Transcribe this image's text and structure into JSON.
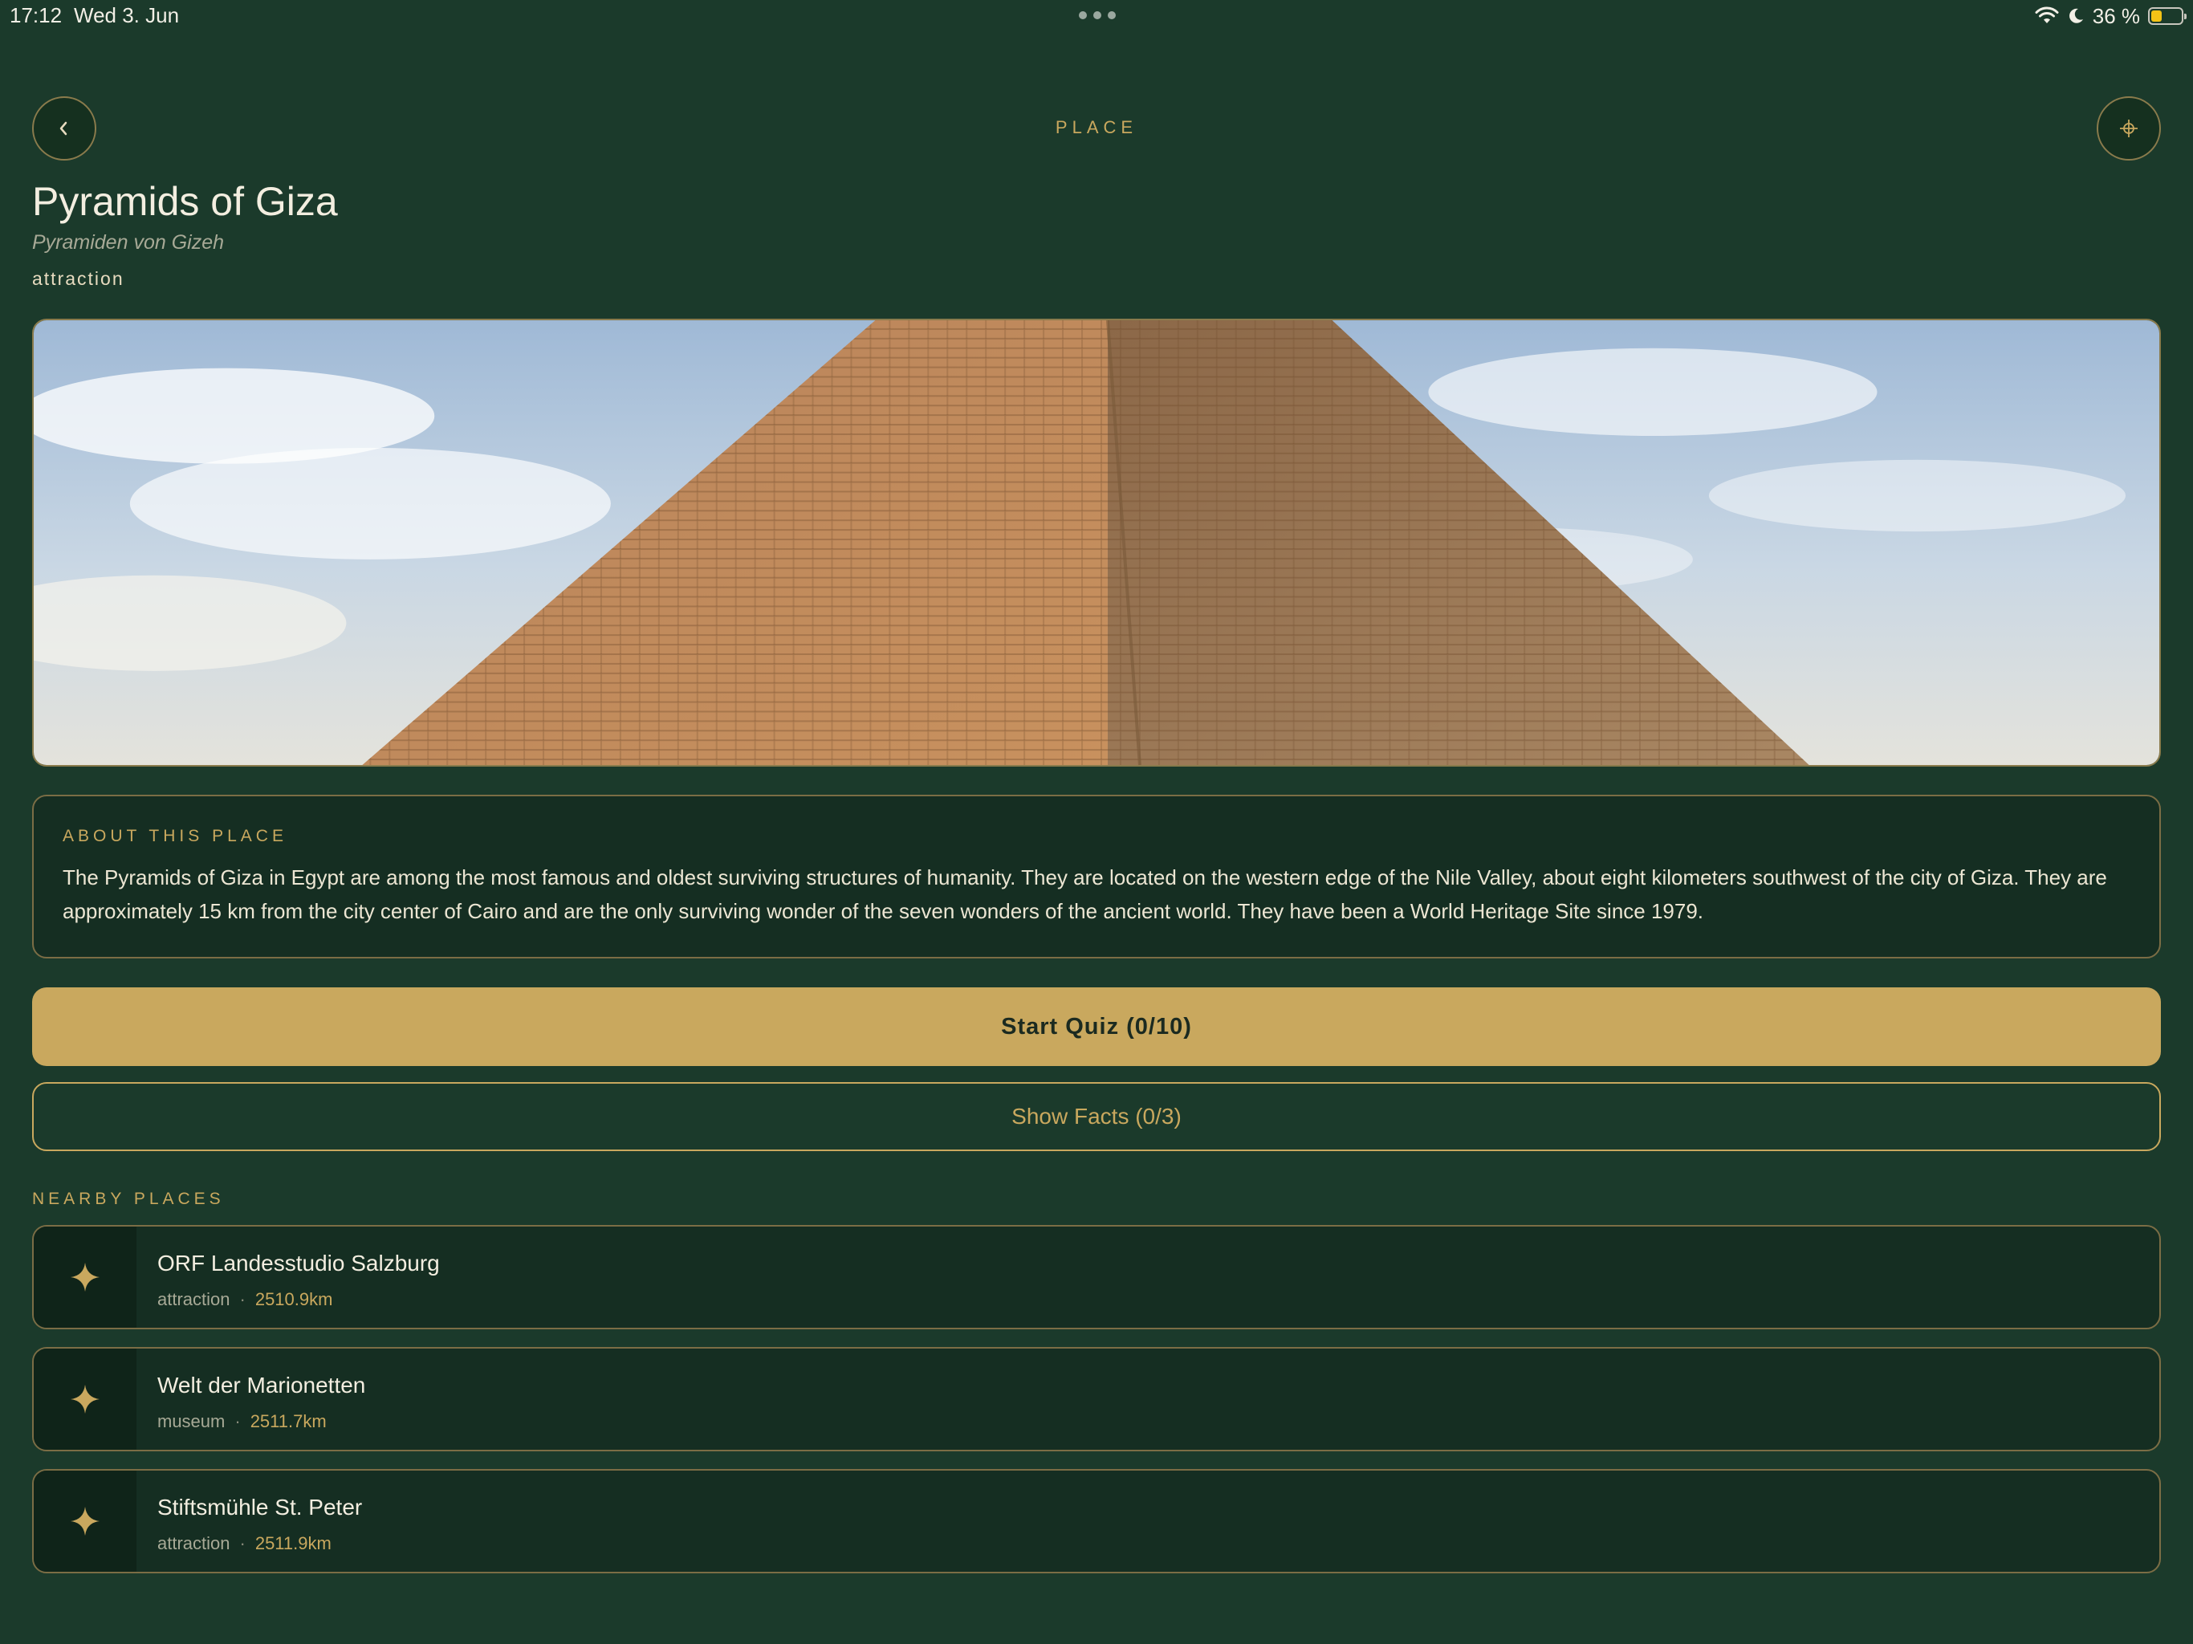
{
  "status_bar": {
    "time": "17:12",
    "date": "Wed 3. Jun",
    "battery_text": "36 %",
    "battery_level": 0.36
  },
  "header": {
    "kicker": "PLACE",
    "back_icon": "chevron-left-icon",
    "locate_icon": "crosshair-icon"
  },
  "place": {
    "title": "Pyramids of Giza",
    "subtitle": "Pyramiden von Gizeh",
    "category": "attraction"
  },
  "about": {
    "heading": "ABOUT THIS PLACE",
    "body": "The Pyramids of Giza in Egypt are among the most famous and oldest surviving structures of humanity. They are located on the western edge of the Nile Valley, about eight kilometers southwest of the city of Giza. They are approximately 15 km from the city center of Cairo and are the only surviving wonder of the seven wonders of the ancient world. They have been a World Heritage Site since 1979."
  },
  "actions": {
    "quiz_label": "Start Quiz (0/10)",
    "facts_label": "Show Facts (0/3)"
  },
  "nearby": {
    "heading": "NEARBY PLACES",
    "items": [
      {
        "name": "ORF Landesstudio Salzburg",
        "category": "attraction",
        "distance": "2510.9km"
      },
      {
        "name": "Welt der Marionetten",
        "category": "museum",
        "distance": "2511.7km"
      },
      {
        "name": "Stiftsmühle St. Peter",
        "category": "attraction",
        "distance": "2511.9km"
      }
    ],
    "separator": "·"
  },
  "colors": {
    "background": "#1b3a2b",
    "accent": "#c9a85e",
    "card": "#152e22"
  }
}
